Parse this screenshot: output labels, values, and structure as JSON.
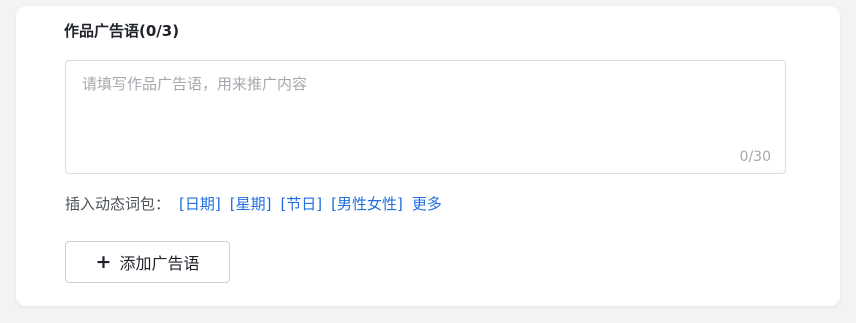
{
  "section": {
    "title": "作品广告语(0/3)"
  },
  "textarea": {
    "placeholder": "请填写作品广告语，用来推广内容",
    "counter": "0/30"
  },
  "vars": {
    "label": "插入动态词包：",
    "tags": [
      "[日期]",
      "[星期]",
      "[节日]",
      "[男性女性]",
      "更多"
    ]
  },
  "add_button": {
    "icon": "plus-icon",
    "label": "添加广告语"
  }
}
